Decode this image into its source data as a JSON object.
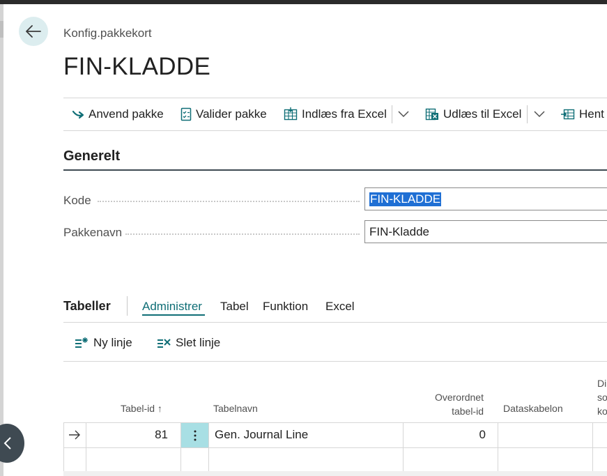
{
  "header": {
    "breadcrumb": "Konfig.pakkekort",
    "title": "FIN-KLADDE"
  },
  "actions": {
    "apply_package": "Anvend pakke",
    "validate_package": "Valider pakke",
    "import_excel": "Indlæs fra Excel",
    "export_excel": "Udlæs til Excel",
    "fetch": "Hent"
  },
  "general": {
    "title": "Generelt",
    "code_label": "Kode",
    "code_value": "FIN-KLADDE",
    "name_label": "Pakkenavn",
    "name_value": "FIN-Kladde"
  },
  "tables_part": {
    "title": "Tabeller",
    "tabs": [
      "Administrer",
      "Tabel",
      "Funktion",
      "Excel"
    ],
    "active_tab": "Administrer",
    "new_line": "Ny linje",
    "delete_line": "Slet linje",
    "columns": {
      "table_id": "Tabel-id",
      "table_id_sort": "↑",
      "table_name": "Tabelnavn",
      "parent_line1": "Overordnet",
      "parent_line2": "tabel-id",
      "data_template": "Dataskabelon",
      "truncated_line1": "Di",
      "truncated_line2": "so",
      "truncated_line3": "ko"
    },
    "rows": [
      {
        "table_id": "81",
        "table_name": "Gen. Journal Line",
        "parent_table_id": "0",
        "data_template": ""
      }
    ]
  },
  "colors": {
    "accent": "#0f6e76",
    "selection": "#1f6fd4",
    "row_menu": "#a8dfe4",
    "back_button": "#dcedef"
  }
}
